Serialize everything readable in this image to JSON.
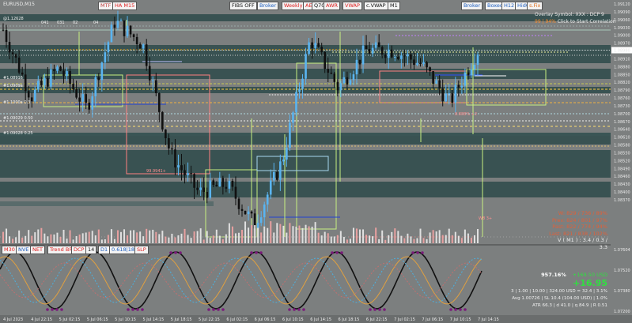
{
  "symbol": "EURUSD,M15",
  "colors": {
    "bg": "#7c7f7f",
    "up": "#5ab4f0",
    "down": "#101010",
    "band": "#2f4f4f",
    "sub_bg": "#7c7f7f"
  },
  "toolbar_buttons": [
    {
      "label": "MTF",
      "color": "#c04040"
    },
    {
      "label": "HA M15",
      "color": "#e02020"
    },
    {
      "label": "FIBS OFF",
      "color": "#111111"
    },
    {
      "label": "Broker",
      "color": "#2060c0"
    },
    {
      "label": "Weekly",
      "color": "#e02020"
    },
    {
      "label": "AE",
      "color": "#e02020"
    },
    {
      "label": "Q70",
      "color": "#111111"
    },
    {
      "label": "AWR",
      "color": "#e02020"
    },
    {
      "label": "VWAP",
      "color": "#e02020"
    },
    {
      "label": "c.VWAP",
      "color": "#111111"
    },
    {
      "label": "M1",
      "color": "#111111"
    },
    {
      "label": "Broker",
      "color": "#2060c0"
    },
    {
      "label": "Boxed",
      "color": "#2060c0"
    },
    {
      "label": "H12",
      "color": "#2060c0"
    },
    {
      "label": "HidO",
      "color": "#2060c0"
    },
    {
      "label": "s.Fix",
      "color": "#e07020"
    }
  ],
  "overlay": {
    "line1": "Overlay Symbol: XXX : DCP 9",
    "line2_a": "99 | 94%",
    "line2_b": "Click to Start Correlation"
  },
  "level_labels": [
    "@1.12628",
    "041",
    "031",
    "02",
    "04",
    "#1.0909a",
    "#1.1000a 0.3",
    "#1.09029 0.50",
    "#1.09028 0.25",
    "#1.08916"
  ],
  "small_labels": [
    "8.888% +2",
    "99.9941+",
    "W8 3+"
  ],
  "stats": {
    "w": "W: 829 / 736 / 89%",
    "prev": "Prev: 824 / 801 / 97%",
    "past": "Past: 822 / 774 / 94%",
    "last": "Last: 821 / 838 / 102%",
    "v": "V ( M1 ) : 3.4 / 0.3 / 3.3"
  },
  "price_axis": [
    "1.09120",
    "1.09090",
    "1.09060",
    "1.09030",
    "1.09000",
    "1.08970",
    "1.08940",
    "1.08910",
    "1.08880",
    "1.08850",
    "1.08820",
    "1.08790",
    "1.08760",
    "1.08730",
    "1.08700",
    "1.08670",
    "1.08640",
    "1.08610",
    "1.08580",
    "1.08550",
    "1.08520",
    "1.08490",
    "1.08460",
    "1.08430",
    "1.08400",
    "1.08370"
  ],
  "price_highlight": {
    "label": "1.08980",
    "color": "#ffffff"
  },
  "time_axis": [
    "4 Jul 2023",
    "4 Jul 22:15",
    "5 Jul 02:15",
    "5 Jul 06:15",
    "5 Jul 10:15",
    "5 Jul 14:15",
    "5 Jul 18:15",
    "5 Jul 22:15",
    "6 Jul 02:15",
    "6 Jul 06:15",
    "6 Jul 10:15",
    "6 Jul 14:15",
    "6 Jul 18:15",
    "6 Jul 22:15",
    "7 Jul 02:15",
    "7 Jul 06:15",
    "7 Jul 10:15",
    "7 Jul 14:15"
  ],
  "sub_buttons": [
    {
      "label": "M30",
      "color": "#e02020"
    },
    {
      "label": "NVE",
      "color": "#2060c0"
    },
    {
      "label": "NET",
      "color": "#e02020"
    },
    {
      "label": "Trend BP",
      "color": "#e02020"
    },
    {
      "label": "DCP",
      "color": "#e02020"
    },
    {
      "label": "14",
      "color": "#111111"
    },
    {
      "label": "D1",
      "color": "#2060c0"
    },
    {
      "label": "0.618|18",
      "color": "#2060c0"
    },
    {
      "label": "SLP",
      "color": "#e02020"
    }
  ],
  "sub_axis": [
    "1.07604",
    "1.07520",
    "1.07380",
    "1.07200"
  ],
  "sub_info": {
    "pct": "957.16%",
    "usd": "+169.50 USD",
    "big": "+16.95",
    "row1": "3 | 1.00 | 10.00 | 324.00 USD = 32.4 | 3.1%",
    "row2": "Avg 1.00726 | SL 10.4 (104.00 USD) | 1.0%",
    "row3": "ATR 66.3 | d 41.0 | q 84.9 | R 0.51"
  },
  "chart_data": {
    "type": "candlestick",
    "symbol": "EURUSD",
    "timeframe": "M15",
    "x_range": [
      "4 Jul 2023",
      "7 Jul 14:15"
    ],
    "ylim": [
      1.0837,
      1.0912
    ],
    "approx_close_path": [
      [
        "4 Jul 2023",
        1.0905
      ],
      [
        "4 Jul 22:15",
        1.0882
      ],
      [
        "5 Jul 02:15",
        1.0892
      ],
      [
        "5 Jul 06:15",
        1.0878
      ],
      [
        "5 Jul 10:15",
        1.0908
      ],
      [
        "5 Jul 14:15",
        1.09
      ],
      [
        "5 Jul 18:15",
        1.0862
      ],
      [
        "5 Jul 22:15",
        1.0849
      ],
      [
        "6 Jul 02:15",
        1.0852
      ],
      [
        "6 Jul 06:15",
        1.0838
      ],
      [
        "6 Jul 10:15",
        1.086
      ],
      [
        "6 Jul 14:15",
        1.0902
      ],
      [
        "6 Jul 18:15",
        1.0885
      ],
      [
        "6 Jul 22:15",
        1.0898
      ],
      [
        "7 Jul 02:15",
        1.0898
      ],
      [
        "7 Jul 06:15",
        1.0893
      ],
      [
        "7 Jul 10:15",
        1.088
      ],
      [
        "7 Jul 14:15",
        1.0898
      ]
    ],
    "current_price": 1.0898,
    "legend": "none",
    "grid": false,
    "subwindow": {
      "type": "oscillator",
      "ylim": [
        1.072,
        1.076
      ],
      "series": [
        {
          "values": [
            0.2,
            0.9,
            0.1,
            0.95,
            0.05,
            0.85,
            0.2,
            0.7,
            0.15,
            0.8,
            0.3,
            0.6
          ]
        }
      ]
    }
  }
}
